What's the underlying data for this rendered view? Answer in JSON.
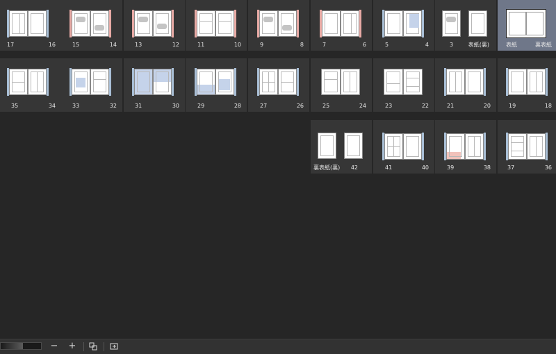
{
  "spreads": {
    "s17_16": {
      "left": "17",
      "right": "16"
    },
    "s15_14": {
      "left": "15",
      "right": "14"
    },
    "s13_12": {
      "left": "13",
      "right": "12"
    },
    "s11_10": {
      "left": "11",
      "right": "10"
    },
    "s9_8": {
      "left": "9",
      "right": "8"
    },
    "s7_6": {
      "left": "7",
      "right": "6"
    },
    "s5_4": {
      "left": "5",
      "right": "4"
    },
    "s3_cover": {
      "left": "3",
      "right": "表紙(裏)"
    },
    "s_cover": {
      "left": "表紙",
      "right": "裏表紙"
    },
    "s35_34": {
      "left": "35",
      "right": "34"
    },
    "s33_32": {
      "left": "33",
      "right": "32"
    },
    "s31_30": {
      "left": "31",
      "right": "30"
    },
    "s29_28": {
      "left": "29",
      "right": "28"
    },
    "s27_26": {
      "left": "27",
      "right": "26"
    },
    "s25_24": {
      "left": "25",
      "right": "24"
    },
    "s23_22": {
      "left": "23",
      "right": "22"
    },
    "s21_20": {
      "left": "21",
      "right": "20"
    },
    "s19_18": {
      "left": "19",
      "right": "18"
    },
    "sback_42": {
      "left": "裏表紙(裏)",
      "right": "42"
    },
    "s41_40": {
      "left": "41",
      "right": "40"
    },
    "s39_38": {
      "left": "39",
      "right": "38"
    },
    "s37_36": {
      "left": "37",
      "right": "36"
    }
  },
  "toolbar": {
    "zoom_out_label": "−",
    "zoom_in_label": "+",
    "zoom_level": 0.55
  },
  "icons": {
    "zoom_out": "minus-icon",
    "zoom_in": "plus-icon",
    "combine_spread": "combine-pages-icon",
    "rotate": "convert-icon"
  },
  "colors": {
    "background": "#262626",
    "tile": "#363636",
    "selected_tile": "#6f7789",
    "bleed_blue": "#a9bfd6",
    "bleed_pink": "#e8aaa5"
  }
}
